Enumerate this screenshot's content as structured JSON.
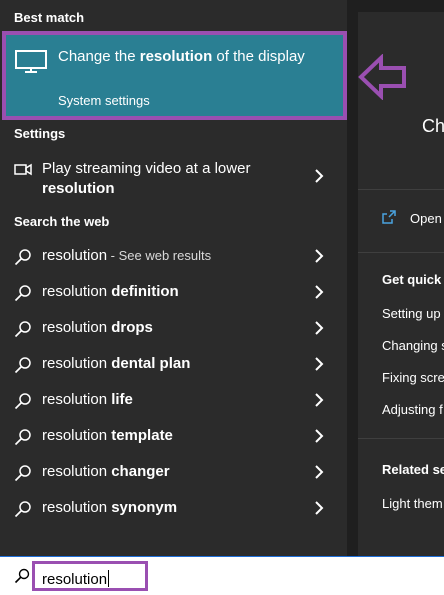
{
  "left_panel": {
    "best_match_heading": "Best match",
    "best_match": {
      "title_pre": "Change the ",
      "title_bold": "resolution",
      "title_post": " of the display",
      "subtitle": "System settings"
    },
    "settings_heading": "Settings",
    "settings_item": {
      "text_pre": "Play streaming video at a lower ",
      "text_bold": "resolution"
    },
    "web_heading": "Search the web",
    "web_results": [
      {
        "query": "resolution",
        "suffix": " - See web results",
        "bold": ""
      },
      {
        "query": "resolution ",
        "suffix": "",
        "bold": "definition"
      },
      {
        "query": "resolution ",
        "suffix": "",
        "bold": "drops"
      },
      {
        "query": "resolution ",
        "suffix": "",
        "bold": "dental plan"
      },
      {
        "query": "resolution ",
        "suffix": "",
        "bold": "life"
      },
      {
        "query": "resolution ",
        "suffix": "",
        "bold": "template"
      },
      {
        "query": "resolution ",
        "suffix": "",
        "bold": "changer"
      },
      {
        "query": "resolution ",
        "suffix": "",
        "bold": "synonym"
      }
    ]
  },
  "right_panel": {
    "title_fragment": "Ch",
    "open_label": "Open",
    "quick_heading": "Get quick l",
    "quick_links": [
      "Setting up",
      "Changing s",
      "Fixing scre",
      "Adjusting f"
    ],
    "related_heading": "Related se",
    "related_links": [
      "Light them"
    ]
  },
  "search": {
    "value": "resolution"
  },
  "icons": {
    "monitor": "monitor-icon",
    "video": "video-icon",
    "search": "search-icon",
    "chevron": "chevron-right-icon",
    "open": "open-external-icon",
    "arrow": "annotation-arrow-left-icon"
  },
  "colors": {
    "accent": "#2a7f93",
    "highlight": "#9a4fb1",
    "panel": "#2b2b2b"
  }
}
